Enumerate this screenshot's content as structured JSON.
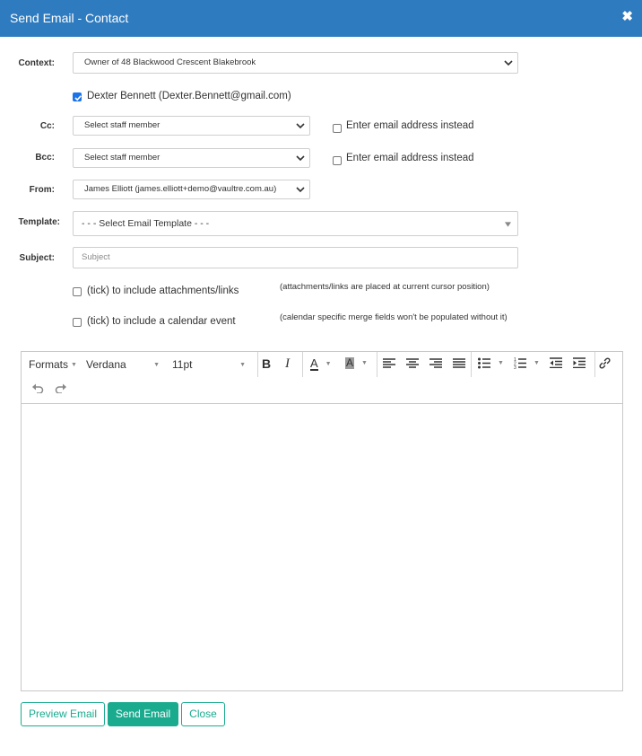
{
  "dialog": {
    "title": "Send Email - Contact",
    "close_glyph": "✖"
  },
  "form": {
    "context_label": "Context:",
    "context_value": "Owner of 48 Blackwood Crescent Blakebrook",
    "recipient": {
      "text": "Dexter Bennett (Dexter.Bennett@gmail.com)",
      "checked": true
    },
    "cc_label": "Cc:",
    "cc_value": "Select staff member",
    "cc_alt": "Enter email address instead",
    "bcc_label": "Bcc:",
    "bcc_value": "Select staff member",
    "bcc_alt": "Enter email address instead",
    "from_label": "From:",
    "from_value": "James Elliott (james.elliott+demo@vaultre.com.au)",
    "template_label": "Template:",
    "template_value": "- - - Select Email Template - - -",
    "subject_label": "Subject:",
    "subject_placeholder": "Subject",
    "attach_text": "(tick) to include attachments/links",
    "attach_note": "(attachments/links are placed at current cursor position)",
    "calendar_text": "(tick) to include a calendar event",
    "calendar_note": "(calendar specific merge fields won't be populated without it)"
  },
  "editor": {
    "formats": "Formats",
    "font": "Verdana",
    "size": "11pt",
    "bold": "B",
    "italic": "I",
    "font_color": "A",
    "bg_color": "A"
  },
  "buttons": {
    "preview": "Preview Email",
    "send": "Send Email",
    "close": "Close"
  },
  "colors": {
    "header": "#2f7bbf",
    "accent": "#1aab8f",
    "checkbox": "#1a73e8"
  }
}
